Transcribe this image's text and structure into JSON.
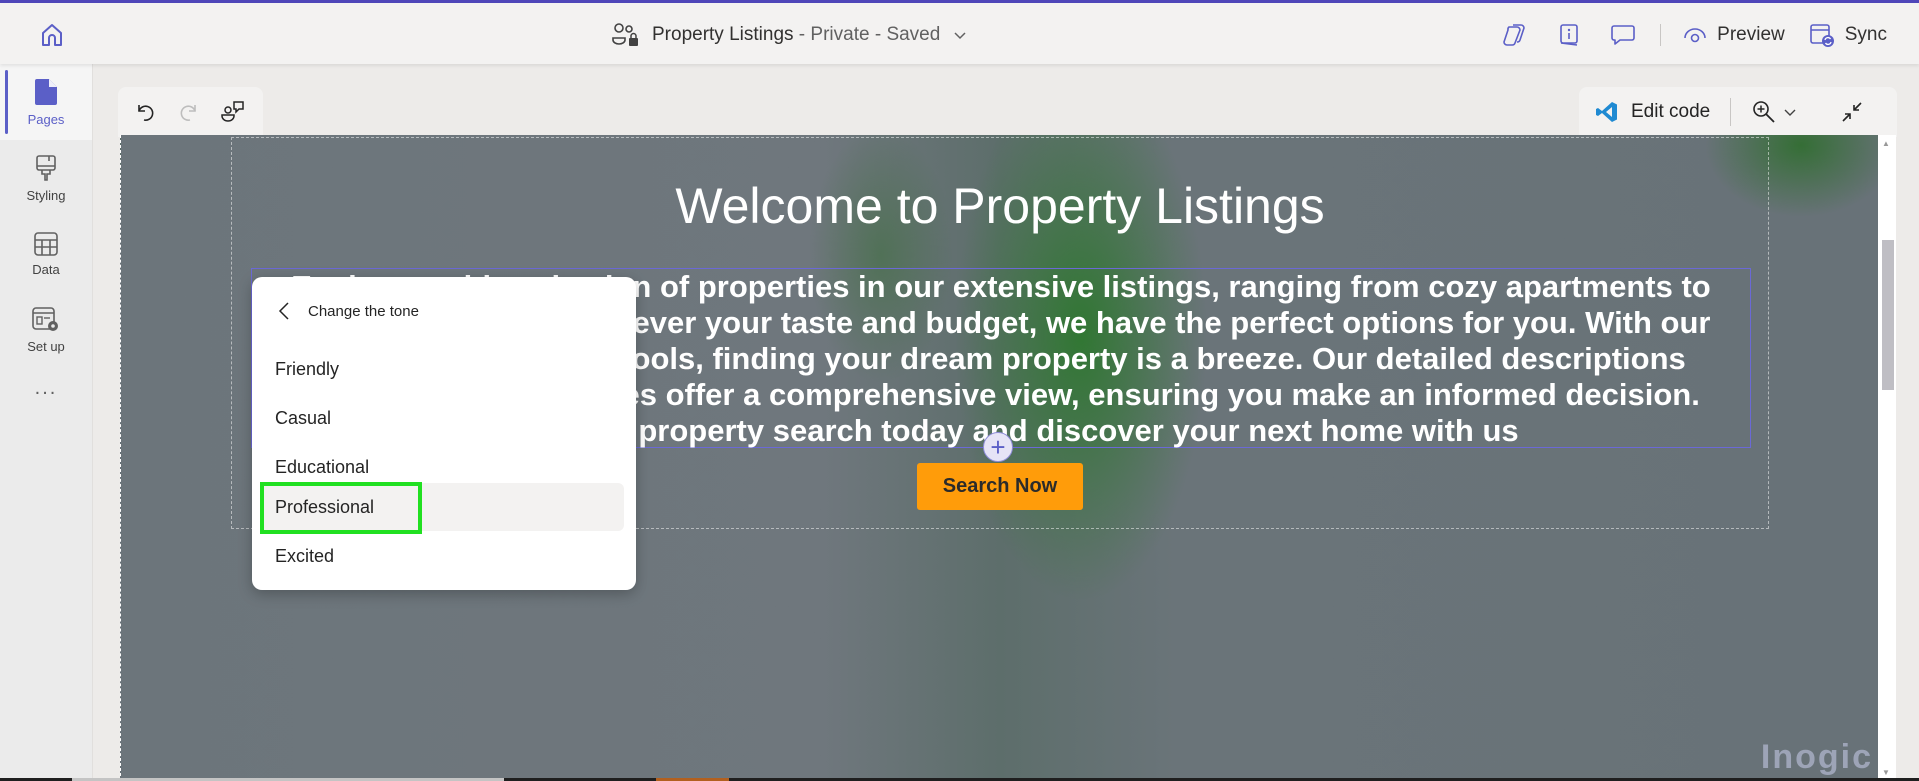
{
  "header": {
    "app_title": "Property Listings",
    "visibility": "Private",
    "save_state": "Saved",
    "separator": " - ",
    "preview_label": "Preview",
    "sync_label": "Sync"
  },
  "sidebar": {
    "items": [
      {
        "label": "Pages",
        "icon": "page-icon",
        "active": true
      },
      {
        "label": "Styling",
        "icon": "paintbrush-icon",
        "active": false
      },
      {
        "label": "Data",
        "icon": "table-icon",
        "active": false
      },
      {
        "label": "Set up",
        "icon": "settings-window-icon",
        "active": false
      }
    ],
    "more_label": "..."
  },
  "canvas_toolbar": {
    "edit_code_label": "Edit code"
  },
  "page": {
    "heading": "Welcome to Property Listings",
    "paragraph_lines": [
      "Explore a wide selection of properties in our extensive listings, ranging from cozy apartments to",
      "luxurious homes. Whatever your taste and budget, we have the perfect options for you. With our",
      "user-friendly search tools, finding your dream property is a breeze. Our detailed descriptions",
      "and high-quality images offer a comprehensive view, ensuring you make an informed decision.",
      "Start your property search today and discover your next home with us"
    ],
    "cta_label": "Search Now",
    "add_label": "+",
    "watermark": "Inogic"
  },
  "tone_menu": {
    "title": "Change the tone",
    "options": [
      "Friendly",
      "Casual",
      "Educational",
      "Professional",
      "Excited"
    ],
    "hovered": "Professional"
  },
  "colors": {
    "accent": "#5b5fc7",
    "top_bar": "#4f46b9",
    "cta": "#ff9c0a",
    "highlight_box": "#21e021"
  }
}
